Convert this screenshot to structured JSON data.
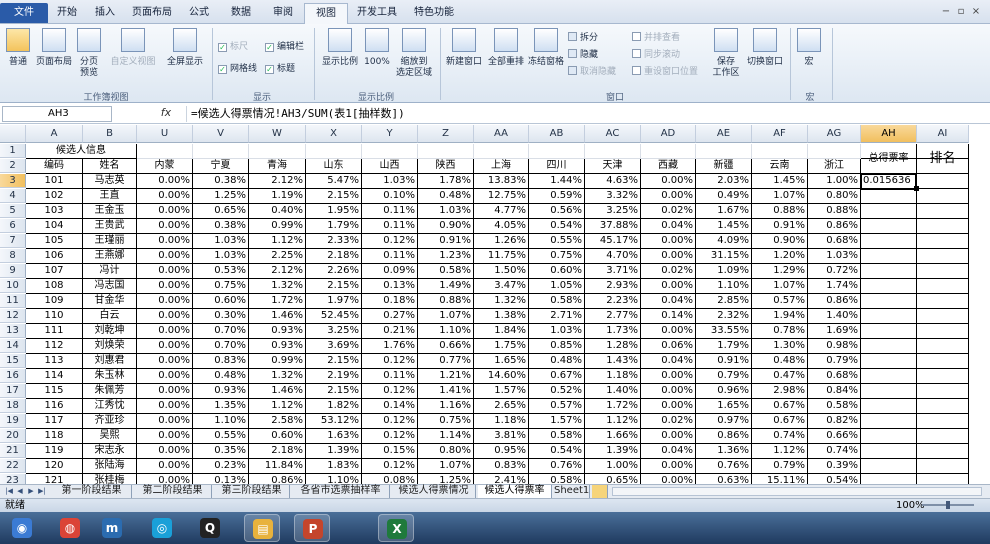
{
  "ribbon_tabs": [
    "文件",
    "开始",
    "插入",
    "页面布局",
    "公式",
    "数据",
    "审阅",
    "视图",
    "开发工具",
    "特色功能"
  ],
  "ribbon": {
    "wb_views": [
      "普通",
      "页面布局",
      "分页\n预览",
      "自定义视图",
      "全屏显示"
    ],
    "wb_views_caption": "工作簿视图",
    "show": {
      "ruler": "标尺",
      "formula_bar": "编辑栏",
      "gridlines": "网格线",
      "headings": "标题"
    },
    "show_caption": "显示",
    "zoom": [
      "显示比例",
      "100%",
      "缩放到\n选定区域"
    ],
    "zoom_caption": "显示比例",
    "window": [
      "新建窗口",
      "全部重排",
      "冻结窗格"
    ],
    "window_small": [
      "拆分",
      "隐藏",
      "取消隐藏"
    ],
    "window_small2": [
      "并排查看",
      "同步滚动",
      "重设窗口位置"
    ],
    "save_ws": "保存\n工作区",
    "switch": "切换窗口",
    "window_caption": "窗口",
    "macro": "宏",
    "macro_caption": "宏"
  },
  "formula_bar": {
    "name_box": "AH3",
    "fx": "fx",
    "formula": "=候选人得票情况!AH3/SUM(表1[抽样数])"
  },
  "columns": [
    "A",
    "B",
    "U",
    "V",
    "W",
    "X",
    "Y",
    "Z",
    "AA",
    "AB",
    "AC",
    "AD",
    "AE",
    "AF",
    "AG",
    "AH",
    "AI"
  ],
  "row1": {
    "A": "候选人信息"
  },
  "header": [
    "编码",
    "姓名",
    "内蒙",
    "宁夏",
    "青海",
    "山东",
    "山西",
    "陕西",
    "上海",
    "四川",
    "天津",
    "西藏",
    "新疆",
    "云南",
    "浙江",
    "总得票率",
    "排名"
  ],
  "rows": [
    [
      "101",
      "马志英",
      "0.00%",
      "0.38%",
      "2.12%",
      "5.47%",
      "1.03%",
      "1.78%",
      "13.83%",
      "1.44%",
      "4.63%",
      "0.00%",
      "2.03%",
      "1.45%",
      "1.00%",
      "0.015636"
    ],
    [
      "102",
      "王直",
      "0.00%",
      "1.25%",
      "1.19%",
      "2.15%",
      "0.10%",
      "0.48%",
      "12.75%",
      "0.59%",
      "3.32%",
      "0.00%",
      "0.49%",
      "1.07%",
      "0.80%",
      ""
    ],
    [
      "103",
      "王金玉",
      "0.00%",
      "0.65%",
      "0.40%",
      "1.95%",
      "0.11%",
      "1.03%",
      "4.77%",
      "0.56%",
      "3.25%",
      "0.02%",
      "1.67%",
      "0.88%",
      "0.88%",
      ""
    ],
    [
      "104",
      "王贵武",
      "0.00%",
      "0.38%",
      "0.99%",
      "1.79%",
      "0.11%",
      "0.90%",
      "4.05%",
      "0.54%",
      "37.88%",
      "0.04%",
      "1.45%",
      "0.91%",
      "0.86%",
      ""
    ],
    [
      "105",
      "王瑾丽",
      "0.00%",
      "1.03%",
      "1.12%",
      "2.33%",
      "0.12%",
      "0.91%",
      "1.26%",
      "0.55%",
      "45.17%",
      "0.00%",
      "4.09%",
      "0.90%",
      "0.68%",
      ""
    ],
    [
      "106",
      "王燕娜",
      "0.00%",
      "1.03%",
      "2.25%",
      "2.18%",
      "0.11%",
      "1.23%",
      "11.75%",
      "0.75%",
      "4.70%",
      "0.00%",
      "31.15%",
      "1.20%",
      "1.03%",
      ""
    ],
    [
      "107",
      "冯计",
      "0.00%",
      "0.53%",
      "2.12%",
      "2.26%",
      "0.09%",
      "0.58%",
      "1.50%",
      "0.60%",
      "3.71%",
      "0.02%",
      "1.09%",
      "1.29%",
      "0.72%",
      ""
    ],
    [
      "108",
      "冯志国",
      "0.00%",
      "0.75%",
      "1.32%",
      "2.15%",
      "0.13%",
      "1.49%",
      "3.47%",
      "1.05%",
      "2.93%",
      "0.00%",
      "1.10%",
      "1.07%",
      "1.74%",
      ""
    ],
    [
      "109",
      "甘金华",
      "0.00%",
      "0.60%",
      "1.72%",
      "1.97%",
      "0.18%",
      "0.88%",
      "1.32%",
      "0.58%",
      "2.23%",
      "0.04%",
      "2.85%",
      "0.57%",
      "0.86%",
      ""
    ],
    [
      "110",
      "白云",
      "0.00%",
      "0.30%",
      "1.46%",
      "52.45%",
      "0.27%",
      "1.07%",
      "1.38%",
      "2.71%",
      "2.77%",
      "0.14%",
      "2.32%",
      "1.94%",
      "1.40%",
      ""
    ],
    [
      "111",
      "刘乾坤",
      "0.00%",
      "0.70%",
      "0.93%",
      "3.25%",
      "0.21%",
      "1.10%",
      "1.84%",
      "1.03%",
      "1.73%",
      "0.00%",
      "33.55%",
      "0.78%",
      "1.69%",
      ""
    ],
    [
      "112",
      "刘焕荣",
      "0.00%",
      "0.70%",
      "0.93%",
      "3.69%",
      "1.76%",
      "0.66%",
      "1.75%",
      "0.85%",
      "1.28%",
      "0.06%",
      "1.79%",
      "1.30%",
      "0.98%",
      ""
    ],
    [
      "113",
      "刘惠君",
      "0.00%",
      "0.83%",
      "0.99%",
      "2.15%",
      "0.12%",
      "0.77%",
      "1.65%",
      "0.48%",
      "1.43%",
      "0.04%",
      "0.91%",
      "0.48%",
      "0.79%",
      ""
    ],
    [
      "114",
      "朱玉林",
      "0.00%",
      "0.48%",
      "1.32%",
      "2.19%",
      "0.11%",
      "1.21%",
      "14.60%",
      "0.67%",
      "1.18%",
      "0.00%",
      "0.79%",
      "0.47%",
      "0.68%",
      ""
    ],
    [
      "115",
      "朱佩芳",
      "0.00%",
      "0.93%",
      "1.46%",
      "2.15%",
      "0.12%",
      "1.41%",
      "1.57%",
      "0.52%",
      "1.40%",
      "0.00%",
      "0.96%",
      "2.98%",
      "0.84%",
      ""
    ],
    [
      "116",
      "江秀忱",
      "0.00%",
      "1.35%",
      "1.12%",
      "1.82%",
      "0.14%",
      "1.16%",
      "2.65%",
      "0.57%",
      "1.72%",
      "0.00%",
      "1.65%",
      "0.67%",
      "0.58%",
      ""
    ],
    [
      "117",
      "齐亚珍",
      "0.00%",
      "1.10%",
      "2.58%",
      "53.12%",
      "0.12%",
      "0.75%",
      "1.18%",
      "1.57%",
      "1.12%",
      "0.02%",
      "0.97%",
      "0.67%",
      "0.82%",
      ""
    ],
    [
      "118",
      "吴熙",
      "0.00%",
      "0.55%",
      "0.60%",
      "1.63%",
      "0.12%",
      "1.14%",
      "3.81%",
      "0.58%",
      "1.66%",
      "0.00%",
      "0.86%",
      "0.74%",
      "0.66%",
      ""
    ],
    [
      "119",
      "宋志永",
      "0.00%",
      "0.35%",
      "2.18%",
      "1.39%",
      "0.15%",
      "0.80%",
      "0.95%",
      "0.54%",
      "1.39%",
      "0.04%",
      "1.36%",
      "1.12%",
      "0.74%",
      ""
    ],
    [
      "120",
      "张陆海",
      "0.00%",
      "0.23%",
      "11.84%",
      "1.83%",
      "0.12%",
      "1.07%",
      "0.83%",
      "0.76%",
      "1.00%",
      "0.00%",
      "0.76%",
      "0.79%",
      "0.39%",
      ""
    ],
    [
      "121",
      "张桂梅",
      "0.00%",
      "0.13%",
      "0.86%",
      "1.10%",
      "0.08%",
      "1.25%",
      "2.41%",
      "0.58%",
      "0.65%",
      "0.00%",
      "0.63%",
      "15.11%",
      "0.54%",
      ""
    ]
  ],
  "sheet_tabs": [
    "第一阶段结果",
    "第二阶段结果",
    "第三阶段结果",
    "各省市选票抽样率",
    "候选人得票情况",
    "候选人得票率",
    "Sheet1"
  ],
  "active_sheet": "候选人得票率",
  "status": "就绪",
  "zoom_pct": "100%",
  "taskbar_apps": [
    {
      "icon": "start-orb-icon",
      "color": "#3b7bd4"
    },
    {
      "icon": "chrome-icon",
      "color": "#db4437"
    },
    {
      "icon": "app-m-icon",
      "color": "#2b6cb0"
    },
    {
      "icon": "app-swirl-icon",
      "color": "#1aa0d8"
    },
    {
      "icon": "qq-icon",
      "color": "#222222"
    },
    {
      "icon": "folder-icon",
      "color": "#e8b23c"
    },
    {
      "icon": "powerpoint-icon",
      "color": "#c4452c"
    },
    {
      "icon": "excel-icon",
      "color": "#1f7a3c"
    }
  ],
  "colors": {
    "file_tab": "#2a5ba8",
    "selected_header": "#f1bf5e"
  }
}
